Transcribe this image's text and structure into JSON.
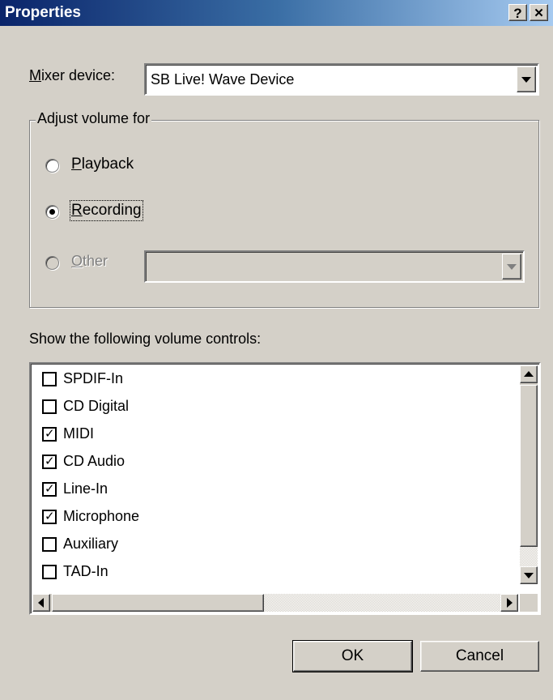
{
  "window": {
    "title": "Properties",
    "help_button": "?",
    "close_button": "✕"
  },
  "mixer": {
    "label_mnemonic": "M",
    "label_rest": "ixer device:",
    "value": "SB Live! Wave Device"
  },
  "adjust_volume": {
    "legend": "Adjust volume for",
    "options": [
      {
        "mnemonic": "P",
        "rest": "layback",
        "selected": false,
        "enabled": true
      },
      {
        "mnemonic": "R",
        "rest": "ecording",
        "selected": true,
        "enabled": true
      },
      {
        "mnemonic": "O",
        "rest": "ther",
        "selected": false,
        "enabled": false
      }
    ],
    "other_select_value": ""
  },
  "volume_controls": {
    "label": "Show the following volume controls:",
    "items": [
      {
        "label": "SPDIF-In",
        "checked": false
      },
      {
        "label": "CD Digital",
        "checked": false
      },
      {
        "label": "MIDI",
        "checked": true
      },
      {
        "label": "CD Audio",
        "checked": true
      },
      {
        "label": "Line-In",
        "checked": true
      },
      {
        "label": "Microphone",
        "checked": true
      },
      {
        "label": "Auxiliary",
        "checked": false
      },
      {
        "label": "TAD-In",
        "checked": false
      }
    ]
  },
  "buttons": {
    "ok": "OK",
    "cancel": "Cancel"
  },
  "icons": {
    "check": "✓"
  }
}
